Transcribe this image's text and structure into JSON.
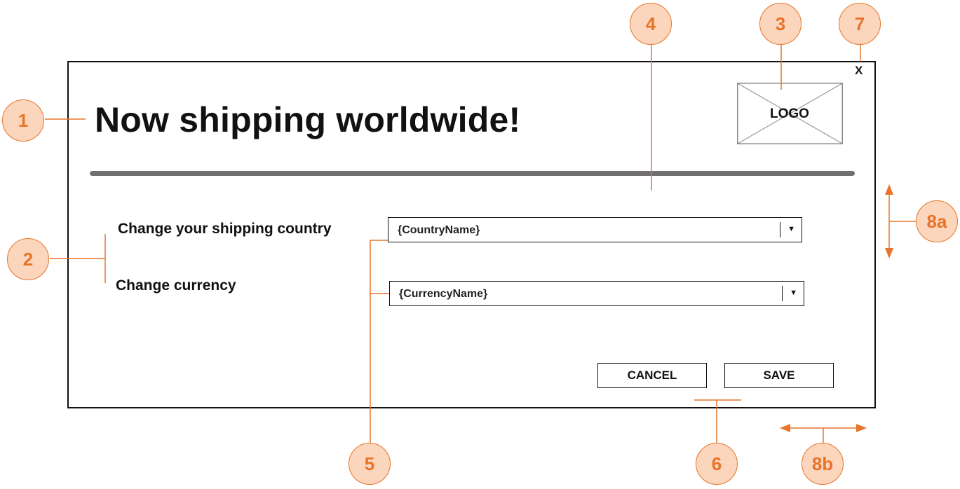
{
  "dialog": {
    "title": "Now shipping worldwide!",
    "close_label": "X",
    "logo_label": "LOGO",
    "country": {
      "label": "Change your shipping country",
      "value": "{CountryName}"
    },
    "currency": {
      "label": "Change currency",
      "value": "{CurrencyName}"
    },
    "cancel_label": "CANCEL",
    "save_label": "SAVE"
  },
  "annotations": [
    "1",
    "2",
    "3",
    "4",
    "5",
    "6",
    "7",
    "8a",
    "8b"
  ],
  "colors": {
    "annotation": "#e8742a",
    "annotation_fill": "#fbd6bd",
    "divider": "#707070"
  },
  "icons": {
    "dropdown": "caret-down-icon",
    "logo": "image-placeholder-icon"
  }
}
